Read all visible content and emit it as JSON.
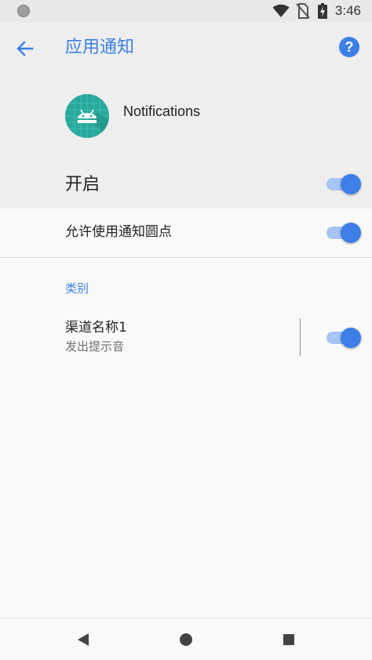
{
  "status_bar": {
    "time": "3:46",
    "icons": [
      "notification-dot-icon",
      "wifi-icon",
      "no-sim-icon",
      "battery-charging-icon"
    ]
  },
  "header": {
    "title": "应用通知",
    "back_icon": "arrow-left-icon",
    "help_icon": "help-circle-icon",
    "help_label": "?"
  },
  "app": {
    "name": "Notifications",
    "icon": "android-icon",
    "icon_color": "#2aa89c"
  },
  "master_toggle": {
    "label": "开启",
    "on": true
  },
  "settings": {
    "allow_dots_label": "允许使用通知圆点",
    "allow_dots_on": true
  },
  "categories": {
    "header": "类别",
    "channels": [
      {
        "name": "渠道名称1",
        "summary": "发出提示音",
        "on": true
      }
    ]
  },
  "nav": {
    "back_icon": "nav-back-triangle-icon",
    "home_icon": "nav-home-circle-icon",
    "recents_icon": "nav-recents-square-icon"
  },
  "colors": {
    "accent": "#3d7fe6",
    "toggle_track": "#a7c4f3",
    "header_bg": "#eeeeee",
    "page_bg": "#fafafa"
  }
}
